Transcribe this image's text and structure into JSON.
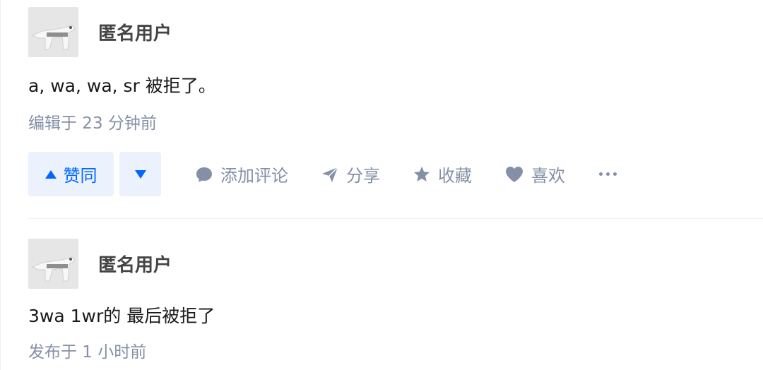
{
  "answers": [
    {
      "author": "匿名用户",
      "content": "a, wa, wa, sr 被拒了。",
      "meta": "编辑于 23 分钟前",
      "actions": {
        "upvote_label": "赞同",
        "comment_label": "添加评论",
        "share_label": "分享",
        "collect_label": "收藏",
        "like_label": "喜欢"
      }
    },
    {
      "author": "匿名用户",
      "content": "3wa 1wr的 最后被拒了",
      "meta": "发布于 1 小时前"
    }
  ],
  "colors": {
    "accent": "#0066ff",
    "vote_bg": "#ebf2fe",
    "meta_text": "#8590a6",
    "author_text": "#444444",
    "content_text": "#1a1a1a"
  },
  "icons": {
    "avatar": "anonymous-avatar-icon",
    "upvote": "triangle-up-icon",
    "downvote": "triangle-down-icon",
    "comment": "comment-bubble-icon",
    "share": "paper-plane-icon",
    "collect": "star-icon",
    "like": "heart-icon",
    "more": "more-dots-icon"
  }
}
